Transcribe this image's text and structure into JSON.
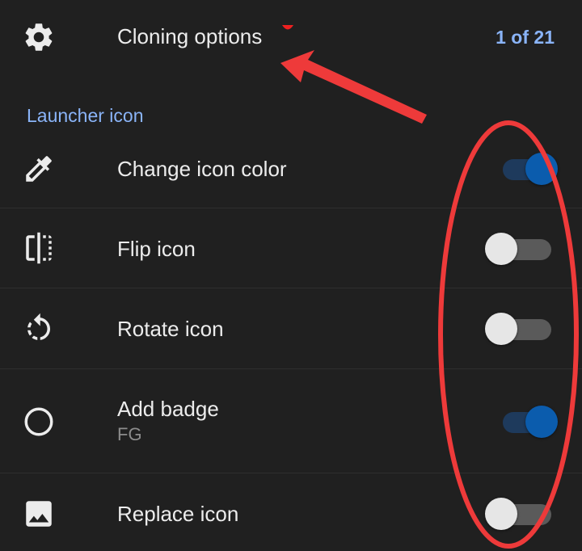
{
  "header": {
    "title": "Cloning options",
    "counter": "1 of 21"
  },
  "section": {
    "label": "Launcher icon"
  },
  "rows": [
    {
      "label": "Change icon color",
      "sublabel": "",
      "icon": "eyedropper-icon",
      "enabled": true
    },
    {
      "label": "Flip icon",
      "sublabel": "",
      "icon": "flip-icon",
      "enabled": false
    },
    {
      "label": "Rotate icon",
      "sublabel": "",
      "icon": "rotate-icon",
      "enabled": false
    },
    {
      "label": "Add badge",
      "sublabel": "FG",
      "icon": "circle-icon",
      "enabled": true
    },
    {
      "label": "Replace icon",
      "sublabel": "",
      "icon": "image-icon",
      "enabled": false
    }
  ],
  "colors": {
    "background": "#202020",
    "accent_text": "#8ab4f8",
    "toggle_on_thumb": "#0b5cad",
    "toggle_on_track": "#1e3a5c",
    "toggle_off_thumb": "#e6e6e6",
    "toggle_off_track": "#5a5a5a",
    "annotation": "#ee3a3a"
  }
}
